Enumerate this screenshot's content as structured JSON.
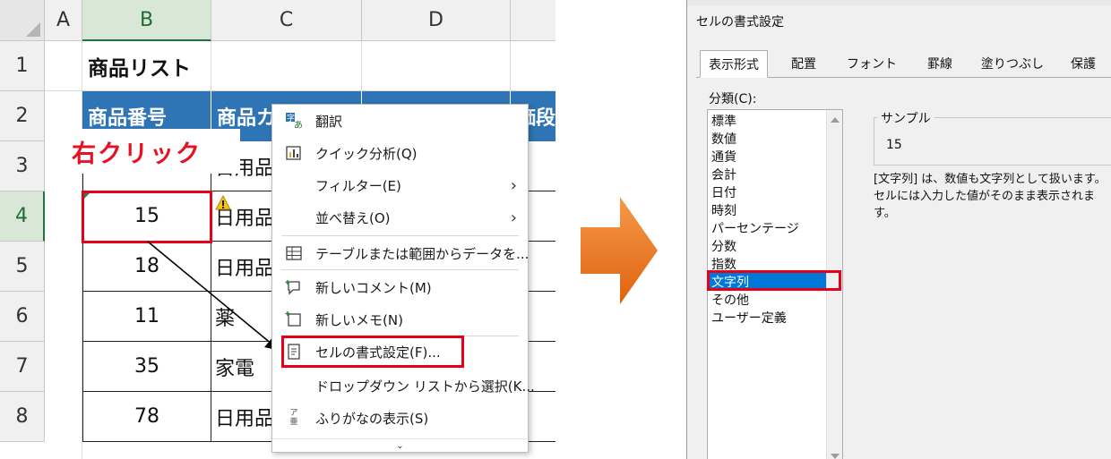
{
  "sheet": {
    "columns": [
      "A",
      "B",
      "C",
      "D"
    ],
    "rows": [
      "1",
      "2",
      "3",
      "4",
      "5",
      "6",
      "7",
      "8"
    ],
    "title": "商品リスト",
    "headers": [
      "商品番号",
      "商品カ",
      "",
      "価段"
    ],
    "b_values": [
      "",
      "15",
      "18",
      "11",
      "35",
      "78"
    ],
    "c_values": [
      "日用品",
      "日用品",
      "日用品",
      "薬",
      "家電",
      "日用品"
    ],
    "callout": "右クリック"
  },
  "context_menu": {
    "items": [
      {
        "icon": "translate-icon",
        "label": "翻訳"
      },
      {
        "icon": "quick-analysis-icon",
        "label": "クイック分析(Q)"
      },
      {
        "icon": "",
        "label": "フィルター(E)",
        "submenu": true
      },
      {
        "icon": "",
        "label": "並べ替え(O)",
        "submenu": true
      },
      {
        "icon": "table-icon",
        "label": "テーブルまたは範囲からデータを..."
      },
      {
        "icon": "new-comment-icon",
        "label": "新しいコメント(M)"
      },
      {
        "icon": "new-note-icon",
        "label": "新しいメモ(N)"
      },
      {
        "icon": "format-cells-icon",
        "label": "セルの書式設定(F)..."
      },
      {
        "icon": "",
        "label": "ドロップダウン リストから選択(K..."
      },
      {
        "icon": "furigana-icon",
        "label": "ふりがなの表示(S)"
      }
    ],
    "furigana_glyph_top": "ア",
    "furigana_glyph_bottom": "亜"
  },
  "dialog": {
    "title": "セルの書式設定",
    "tabs": [
      "表示形式",
      "配置",
      "フォント",
      "罫線",
      "塗りつぶし",
      "保護"
    ],
    "category_label": "分類(C):",
    "categories": [
      "標準",
      "数値",
      "通貨",
      "会計",
      "日付",
      "時刻",
      "パーセンテージ",
      "分数",
      "指数",
      "文字列",
      "その他",
      "ユーザー定義"
    ],
    "selected_category": "文字列",
    "sample_label": "サンプル",
    "sample_value": "15",
    "description": "[文字列] は、数値も文字列として扱います。セルには入力した値がそのまま表示されます。"
  },
  "colors": {
    "header_fill": "#2f75b5",
    "highlight_red": "#e8001b",
    "selection_blue": "#0078d7",
    "arrow_orange": "#f07a1c"
  }
}
